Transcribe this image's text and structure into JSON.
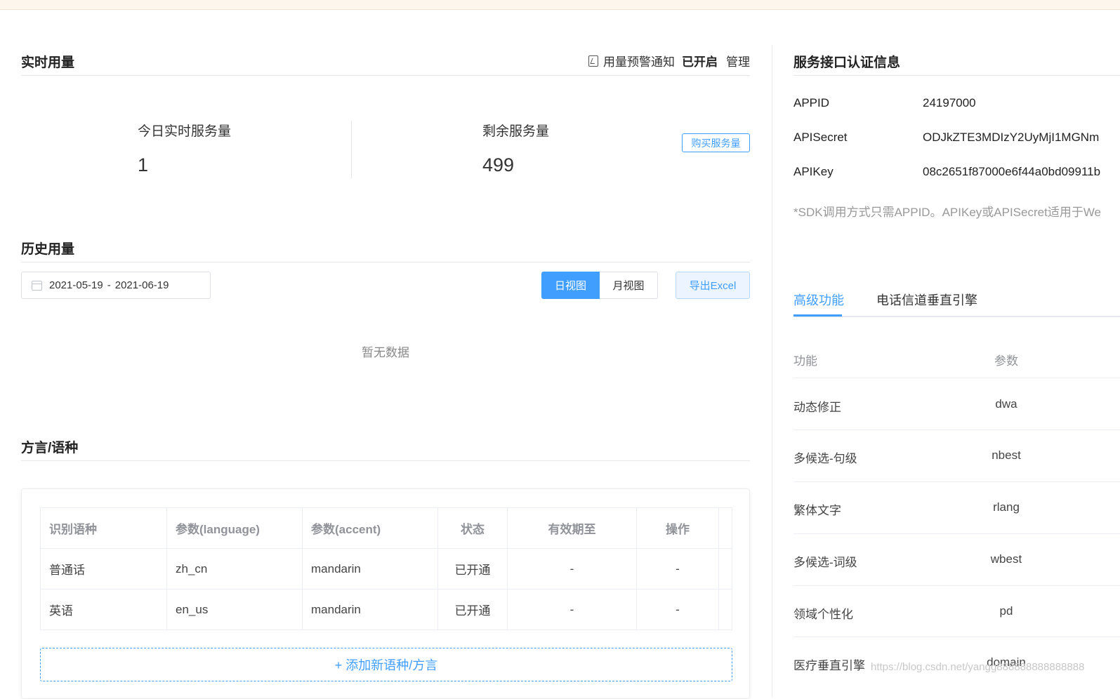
{
  "realtime": {
    "title": "实时用量",
    "alert_label": "用量预警通知",
    "alert_status": "已开启",
    "manage_label": "管理",
    "today_label": "今日实时服务量",
    "today_value": "1",
    "remaining_label": "剩余服务量",
    "remaining_value": "499",
    "buy_label": "购买服务量"
  },
  "history": {
    "title": "历史用量",
    "date_start": "2021-05-19",
    "date_sep": "-",
    "date_end": "2021-06-19",
    "day_view": "日视图",
    "month_view": "月视图",
    "export_label": "导出Excel",
    "no_data": "暂无数据"
  },
  "dialect": {
    "title": "方言/语种",
    "headers": [
      "识别语种",
      "参数(language)",
      "参数(accent)",
      "状态",
      "有效期至",
      "操作"
    ],
    "rows": [
      [
        "普通话",
        "zh_cn",
        "mandarin",
        "已开通",
        "-",
        "-"
      ],
      [
        "英语",
        "en_us",
        "mandarin",
        "已开通",
        "-",
        "-"
      ]
    ],
    "add_label": "+ 添加新语种/方言"
  },
  "credentials": {
    "title": "服务接口认证信息",
    "items": [
      {
        "key": "APPID",
        "value": "24197000"
      },
      {
        "key": "APISecret",
        "value": "ODJkZTE3MDIzY2UyMjI1MGNm"
      },
      {
        "key": "APIKey",
        "value": "08c2651f87000e6f44a0bd09911b"
      }
    ],
    "sdk_note": "*SDK调用方式只需APPID。APIKey或APISecret适用于We"
  },
  "advanced": {
    "tabs": [
      "高级功能",
      "电话信道垂直引擎"
    ],
    "col_feature": "功能",
    "col_param": "参数",
    "features": [
      {
        "name": "动态修正",
        "param": "dwa"
      },
      {
        "name": "多候选-句级",
        "param": "nbest"
      },
      {
        "name": "繁体文字",
        "param": "rlang"
      },
      {
        "name": "多候选-词级",
        "param": "wbest"
      },
      {
        "name": "领域个性化",
        "param": "pd"
      },
      {
        "name": "医疗垂直引擎",
        "param": "domain"
      }
    ]
  },
  "watermark": "https://blog.csdn.net/yangg888888888888888",
  "colors": {
    "accent": "#409eff",
    "banner": "#fdf6ec"
  }
}
